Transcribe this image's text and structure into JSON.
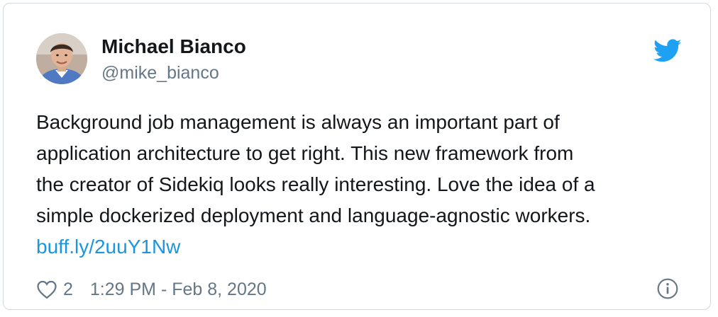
{
  "author": {
    "display_name": "Michael Bianco",
    "handle": "@mike_bianco",
    "avatar": "user-avatar"
  },
  "tweet": {
    "lines": [
      "Background job management is always an important part of",
      "application architecture to get right. This new framework from",
      "the creator of Sidekiq looks really interesting. Love the idea of a",
      "simple dockerized deployment and language-agnostic workers."
    ],
    "link": "buff.ly/2uuY1Nw"
  },
  "footer": {
    "likes": "2",
    "timestamp": "1:29 PM - Feb 8, 2020"
  },
  "icons": {
    "brand": "twitter-bird-icon",
    "like": "heart-icon",
    "info": "info-icon"
  },
  "colors": {
    "name": "#14171a",
    "secondary_text": "#657786",
    "link": "#1b95e0",
    "twitter_blue": "#1da1f2",
    "border": "#cfd9de"
  }
}
